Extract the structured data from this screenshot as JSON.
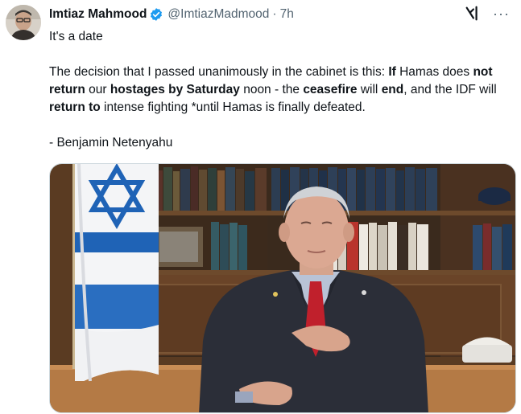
{
  "author": {
    "display_name": "Imtiaz Mahmood",
    "handle": "@ImtiazMadmood",
    "separator": "·",
    "timestamp": "7h",
    "verified_icon": "verified-badge-icon",
    "verified_color": "#1d9bf0"
  },
  "actions": {
    "grok_icon": "grok-icon",
    "more_icon": "more-icon",
    "more_label": "···"
  },
  "tweet": {
    "line1": "It's a date",
    "p1": "The decision that I passed unanimously in the cabinet is this: ",
    "b1": "If",
    "p2": " Hamas does ",
    "b2": "not return",
    "p3": " our ",
    "b3": "hostages by Saturday",
    "p4": " noon - the ",
    "b4": "ceasefire",
    "p5": " will ",
    "b5": "end",
    "p6": ", and the IDF will ",
    "b6": "return to",
    "p7": " intense fighting *until Hamas is finally defeated.",
    "attribution": "- Benjamin Netenyahu"
  },
  "media": {
    "kind": "video-still",
    "subject": "speaker-at-desk",
    "flag": "israel-flag"
  }
}
